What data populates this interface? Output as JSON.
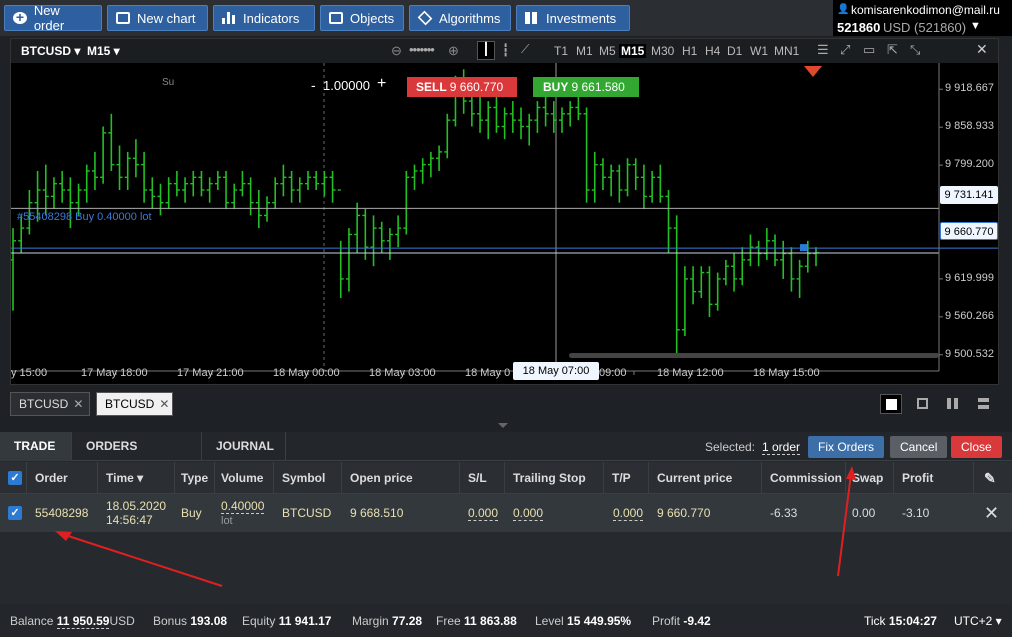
{
  "toolbar": {
    "buttons": [
      "New order",
      "New chart",
      "Indicators",
      "Objects",
      "Algorithms",
      "Investments"
    ]
  },
  "account": {
    "email": "komisarenkodimon@mail.ru",
    "number": "521860",
    "currency": "USD (521860)"
  },
  "chart": {
    "symbol": "BTCUSD",
    "timeframe": "M15",
    "timeframes": [
      "T1",
      "M1",
      "M5",
      "M15",
      "M30",
      "H1",
      "H4",
      "D1",
      "W1",
      "MN1"
    ],
    "active_timeframe": "M15",
    "day_label": "Su",
    "lot_prefix": "-",
    "lot_value": "1.00000",
    "lot_suffix": "+",
    "sell_label": "SELL",
    "sell_price": "9 660.770",
    "buy_label": "BUY",
    "buy_price": "9 661.580",
    "order_line_label": "#55408298 Buy 0.40000 lot",
    "crosshair_price": "9 731.141",
    "current_price": "9 660.770",
    "crosshair_time": "18 May 07:00",
    "colors": {
      "candle": "#22c022",
      "sell": "#d9393a",
      "buy": "#32a832",
      "order_line": "#3a79d8"
    }
  },
  "chart_data": {
    "type": "bar",
    "title": "",
    "price_ticks": [
      "9 918.667",
      "9 858.933",
      "9 799.200",
      "9 619.999",
      "9 560.266",
      "9 500.532"
    ],
    "price_tick_values": [
      9918.667,
      9858.933,
      9799.2,
      9619.999,
      9560.266,
      9500.532
    ],
    "time_ticks": [
      "y 15:00",
      "17 May 18:00",
      "17 May 21:00",
      "18 May 00:00",
      "18 May 03:00",
      "18 May 0",
      "09:00",
      "18 May 12:00",
      "18 May 15:00"
    ],
    "ylim": [
      9475,
      9960
    ],
    "series": [
      {
        "values": [
          [
            9650,
            9700,
            9570,
            9680
          ],
          [
            9680,
            9720,
            9660,
            9700
          ],
          [
            9700,
            9760,
            9690,
            9740
          ],
          [
            9740,
            9790,
            9710,
            9760
          ],
          [
            9760,
            9800,
            9720,
            9750
          ],
          [
            9750,
            9780,
            9730,
            9770
          ],
          [
            9770,
            9790,
            9740,
            9760
          ],
          [
            9760,
            9780,
            9700,
            9740
          ],
          [
            9740,
            9770,
            9720,
            9760
          ],
          [
            9760,
            9800,
            9740,
            9790
          ],
          [
            9790,
            9820,
            9760,
            9780
          ],
          [
            9780,
            9860,
            9770,
            9850
          ],
          [
            9850,
            9880,
            9790,
            9800
          ],
          [
            9800,
            9830,
            9760,
            9780
          ],
          [
            9780,
            9820,
            9760,
            9810
          ],
          [
            9810,
            9840,
            9780,
            9800
          ],
          [
            9800,
            9820,
            9740,
            9760
          ],
          [
            9760,
            9780,
            9730,
            9750
          ],
          [
            9750,
            9770,
            9720,
            9740
          ],
          [
            9740,
            9780,
            9730,
            9770
          ],
          [
            9770,
            9790,
            9750,
            9760
          ],
          [
            9760,
            9780,
            9740,
            9770
          ],
          [
            9770,
            9790,
            9750,
            9780
          ],
          [
            9780,
            9790,
            9750,
            9760
          ],
          [
            9760,
            9780,
            9740,
            9770
          ],
          [
            9770,
            9790,
            9760,
            9780
          ],
          [
            9780,
            9790,
            9730,
            9740
          ],
          [
            9740,
            9770,
            9730,
            9760
          ],
          [
            9760,
            9790,
            9750,
            9770
          ],
          [
            9770,
            9780,
            9720,
            9740
          ],
          [
            9740,
            9760,
            9700,
            9720
          ],
          [
            9720,
            9750,
            9710,
            9740
          ],
          [
            9740,
            9780,
            9730,
            9770
          ],
          [
            9770,
            9800,
            9750,
            9780
          ],
          [
            9780,
            9790,
            9740,
            9760
          ],
          [
            9760,
            9780,
            9740,
            9770
          ],
          [
            9770,
            9790,
            9760,
            9780
          ],
          [
            9780,
            9790,
            9760,
            9770
          ],
          [
            9770,
            9790,
            9750,
            9780
          ],
          [
            9780,
            9790,
            9740,
            9760
          ],
          [
            9760,
            9680,
            9590,
            9620
          ],
          [
            9620,
            9700,
            9600,
            9690
          ],
          [
            9690,
            9740,
            9660,
            9720
          ],
          [
            9720,
            9730,
            9650,
            9670
          ],
          [
            9670,
            9720,
            9640,
            9700
          ],
          [
            9700,
            9710,
            9660,
            9680
          ],
          [
            9680,
            9700,
            9650,
            9690
          ],
          [
            9690,
            9720,
            9670,
            9700
          ],
          [
            9700,
            9790,
            9690,
            9780
          ],
          [
            9780,
            9800,
            9760,
            9790
          ],
          [
            9790,
            9810,
            9770,
            9800
          ],
          [
            9800,
            9820,
            9780,
            9810
          ],
          [
            9810,
            9830,
            9790,
            9820
          ],
          [
            9820,
            9880,
            9810,
            9870
          ],
          [
            9870,
            9940,
            9860,
            9930
          ],
          [
            9930,
            9950,
            9880,
            9900
          ],
          [
            9900,
            9920,
            9860,
            9880
          ],
          [
            9880,
            9910,
            9850,
            9870
          ],
          [
            9870,
            9900,
            9840,
            9890
          ],
          [
            9890,
            9910,
            9850,
            9860
          ],
          [
            9860,
            9890,
            9840,
            9880
          ],
          [
            9880,
            9900,
            9850,
            9870
          ],
          [
            9870,
            9890,
            9840,
            9860
          ],
          [
            9860,
            9880,
            9830,
            9870
          ],
          [
            9870,
            9900,
            9850,
            9890
          ],
          [
            9890,
            9910,
            9860,
            9880
          ],
          [
            9880,
            9900,
            9850,
            9870
          ],
          [
            9870,
            9890,
            9850,
            9880
          ],
          [
            9880,
            9900,
            9860,
            9890
          ],
          [
            9890,
            9910,
            9870,
            9880
          ],
          [
            9880,
            9890,
            9740,
            9760
          ],
          [
            9760,
            9820,
            9740,
            9800
          ],
          [
            9800,
            9810,
            9760,
            9780
          ],
          [
            9780,
            9800,
            9750,
            9790
          ],
          [
            9790,
            9800,
            9740,
            9760
          ],
          [
            9760,
            9810,
            9750,
            9800
          ],
          [
            9800,
            9810,
            9760,
            9780
          ],
          [
            9780,
            9800,
            9730,
            9750
          ],
          [
            9750,
            9790,
            9740,
            9780
          ],
          [
            9780,
            9800,
            9740,
            9750
          ],
          [
            9750,
            9760,
            9660,
            9700
          ],
          [
            9700,
            9720,
            9500,
            9540
          ],
          [
            9540,
            9640,
            9530,
            9620
          ],
          [
            9620,
            9640,
            9580,
            9600
          ],
          [
            9600,
            9640,
            9590,
            9630
          ],
          [
            9630,
            9640,
            9560,
            9580
          ],
          [
            9580,
            9630,
            9570,
            9620
          ],
          [
            9620,
            9650,
            9610,
            9640
          ],
          [
            9640,
            9660,
            9600,
            9620
          ],
          [
            9620,
            9670,
            9610,
            9650
          ],
          [
            9650,
            9690,
            9640,
            9670
          ],
          [
            9670,
            9680,
            9640,
            9660
          ],
          [
            9660,
            9700,
            9650,
            9680
          ],
          [
            9680,
            9690,
            9640,
            9650
          ],
          [
            9650,
            9680,
            9620,
            9660
          ],
          [
            9660,
            9670,
            9600,
            9620
          ],
          [
            9620,
            9650,
            9590,
            9640
          ],
          [
            9640,
            9680,
            9630,
            9660
          ],
          [
            9660,
            9670,
            9640,
            9661
          ]
        ]
      }
    ]
  },
  "chart_tabs": [
    {
      "label": "BTCUSD",
      "close": "✕"
    },
    {
      "label": "BTCUSD",
      "close": "✕"
    }
  ],
  "panel": {
    "tabs": [
      "TRADE",
      "ORDERS HISTORY",
      "JOURNAL"
    ],
    "selected_prefix": "Selected:",
    "selected_value": "1 order",
    "fix_orders": "Fix Orders",
    "cancel": "Cancel",
    "close": "Close",
    "columns": [
      "Order",
      "Time ▾",
      "Type",
      "Volume",
      "Symbol",
      "Open price",
      "S/L",
      "Trailing Stop",
      "T/P",
      "Current price",
      "Commission",
      "Swap",
      "Profit"
    ],
    "row": {
      "order": "55408298",
      "date": "18.05.2020",
      "time": "14:56:47",
      "type": "Buy",
      "volume": "0.40000",
      "volume_unit": "lot",
      "symbol": "BTCUSD",
      "open_price": "9 668.510",
      "sl": "0.000",
      "trailing": "0.000",
      "tp": "0.000",
      "current_price": "9 660.770",
      "commission": "-6.33",
      "swap": "0.00",
      "profit": "-3.10"
    }
  },
  "status": {
    "balance_label": "Balance",
    "balance": "11 950.59",
    "balance_cur": "USD",
    "bonus_label": "Bonus",
    "bonus": "193.08",
    "equity_label": "Equity",
    "equity": "11 941.17",
    "margin_label": "Margin",
    "margin": "77.28",
    "free_label": "Free",
    "free": "11 863.88",
    "level_label": "Level",
    "level": "15 449.95%",
    "profit_label": "Profit",
    "profit": "-9.42",
    "tick_label": "Tick",
    "tick": "15:04:27",
    "tz": "UTC+2"
  }
}
